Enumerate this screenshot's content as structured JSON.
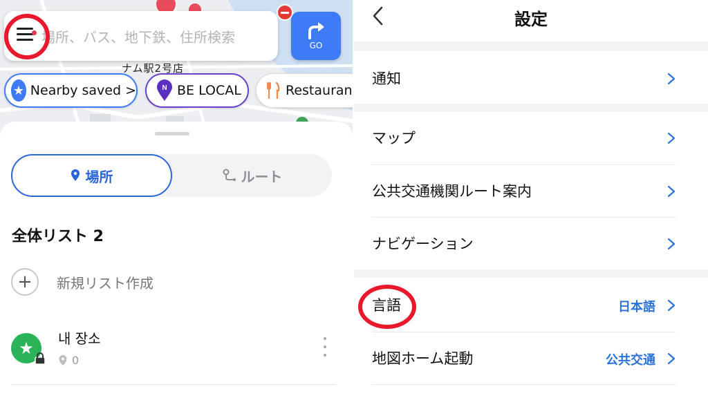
{
  "left": {
    "map": {
      "station_label": "ナム駅2号店"
    },
    "search": {
      "placeholder": "場所、バス、地下鉄、住所検索",
      "go_label": "GO"
    },
    "chips": [
      {
        "label": "Nearby saved >",
        "icon": "star-circle-icon",
        "color": "#3d7bf7"
      },
      {
        "label": "BE LOCAL",
        "icon": "local-pin-icon",
        "color": "#6a3fc9"
      },
      {
        "label": "Restaurant",
        "icon": "fork-knife-icon",
        "color": "#f08a4b"
      }
    ],
    "tabs": {
      "place": "場所",
      "route": "ルート"
    },
    "list_title": "全体リスト 2",
    "new_list_label": "新規リスト作成",
    "my_place": {
      "name": "내 장소",
      "count": "0"
    }
  },
  "right": {
    "title": "設定",
    "items": [
      {
        "label": "通知",
        "value": ""
      },
      {
        "label": "マップ",
        "value": ""
      },
      {
        "label": "公共交通機関ルート案内",
        "value": ""
      },
      {
        "label": "ナビゲーション",
        "value": ""
      },
      {
        "label": "言語",
        "value": "日本語"
      },
      {
        "label": "地図ホーム起動",
        "value": "公共交通"
      }
    ]
  },
  "colors": {
    "accent_blue": "#2a66d9",
    "highlight_red": "#e8192c",
    "green": "#2bb358"
  }
}
